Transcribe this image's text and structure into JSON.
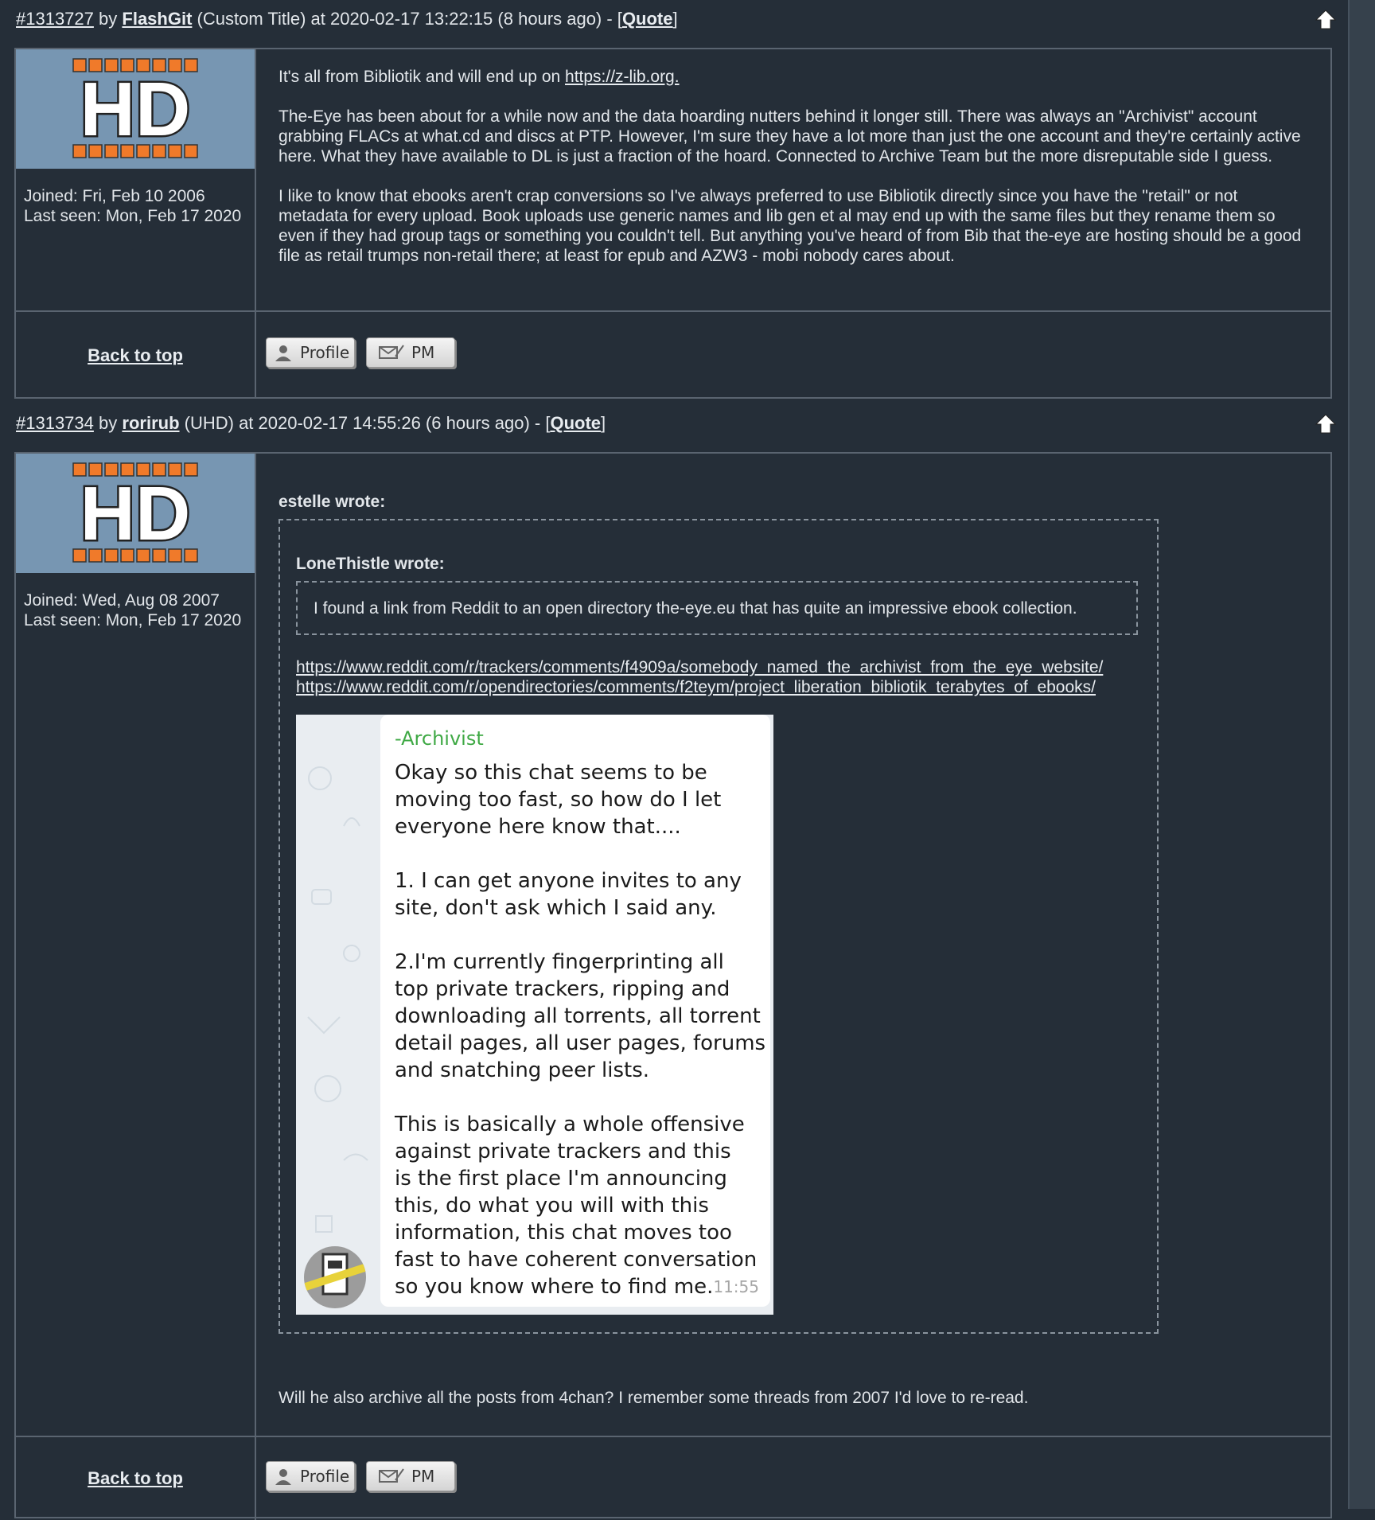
{
  "posts": [
    {
      "id_link": "#1313727",
      "by": "by",
      "author": "FlashGit",
      "meta": "(Custom Title) at 2020-02-17 13:22:15 (8 hours ago) - [",
      "quote_link": "Quote",
      "quote_close": "]",
      "joined": "Joined: Fri, Feb 10 2006",
      "last_seen": "Last seen: Mon, Feb 17 2020",
      "body": {
        "p1_text": "It's all from Bibliotik and will end up on ",
        "p1_link": "https://z-lib.org.",
        "p2": "The-Eye has been about for a while now and the data hoarding nutters behind it longer still. There was always an \"Archivist\" account grabbing FLACs at what.cd and discs at PTP. However, I'm sure they have a lot more than just the one account and they're certainly active here. What they have available to DL is just a fraction of the hoard. Connected to Archive Team but the more disreputable side I guess.",
        "p3": "I like to know that ebooks aren't crap conversions so I've always preferred to use Bibliotik directly since you have the \"retail\" or not metadata for every upload. Book uploads use generic names and lib gen et al may end up with the same files but they rename them so even if they had group tags or something you couldn't tell. But anything you've heard of from Bib that the-eye are hosting should be a good file as retail trumps non-retail there; at least for epub and AZW3 - mobi nobody cares about."
      },
      "back_to_top": "Back to top",
      "profile_btn": "Profile",
      "pm_btn": "PM"
    },
    {
      "id_link": "#1313734",
      "by": "by",
      "author": "rorirub",
      "meta": "(UHD) at 2020-02-17 14:55:26 (6 hours ago) - [",
      "quote_link": "Quote",
      "quote_close": "]",
      "joined": "Joined: Wed, Aug 08 2007",
      "last_seen": "Last seen: Mon, Feb 17 2020",
      "outer_quote_author": "estelle wrote:",
      "inner_quote_author": "LoneThistle wrote:",
      "inner_quote_text": "I found a link from Reddit to an open directory the-eye.eu that has quite an impressive ebook collection.",
      "link1": "https://www.reddit.com/r/trackers/comments/f4909a/somebody_named_the_archivist_from_the_eye_website/",
      "link2": "https://www.reddit.com/r/opendirectories/comments/f2teym/project_liberation_bibliotik_terabytes_of_ebooks/",
      "chat": {
        "sender": "-Archivist",
        "message": "Okay so this chat seems to be\nmoving too fast, so how do I let\neveryone here know that....\n\n1. I can get anyone invites to any\nsite, don't ask which I said any.\n\n2.I'm currently fingerprinting all\ntop private trackers, ripping and\ndownloading all torrents, all torrent\ndetail pages, all user pages, forums\nand snatching peer lists.\n\nThis is basically a whole offensive\nagainst private trackers and this\nis the first place I'm announcing\nthis, do what you will with this\ninformation, this chat moves too\nfast to have coherent conversation\nso you know where to find me.",
        "time": "11:55"
      },
      "reply": "Will he also archive all the posts from 4chan? I remember some threads from 2007 I'd love to re-read.",
      "back_to_top": "Back to top",
      "profile_btn": "Profile",
      "pm_btn": "PM"
    }
  ],
  "avatar_text": "HD",
  "colors": {
    "background": "#252e38",
    "border": "#5a6470",
    "avatar_bg": "#7796b2",
    "avatar_squares": "#f07a2a",
    "chat_sender": "#3fa945"
  }
}
